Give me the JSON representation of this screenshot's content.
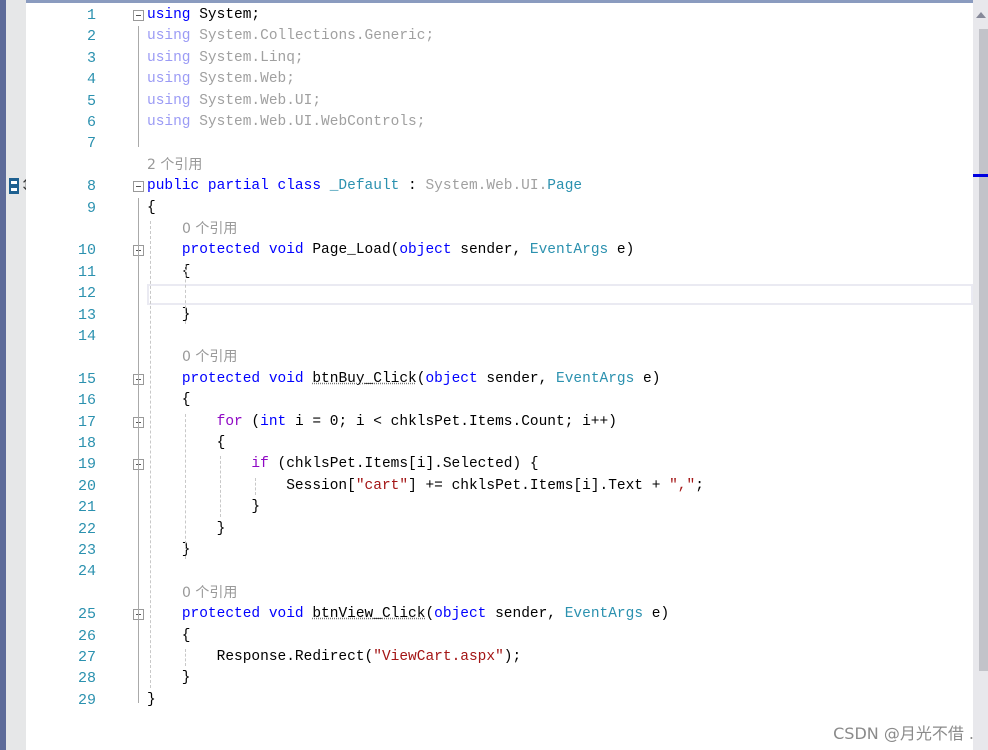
{
  "editor": {
    "rows": [
      {
        "num": "1",
        "tokens": [
          [
            "using",
            "kw"
          ],
          [
            " System;",
            "plain"
          ]
        ]
      },
      {
        "num": "2",
        "tokens": [
          [
            "using",
            "fkw"
          ],
          [
            " System.Collections.Generic;",
            "fade"
          ]
        ]
      },
      {
        "num": "3",
        "tokens": [
          [
            "using",
            "fkw"
          ],
          [
            " System.Linq;",
            "fade"
          ]
        ]
      },
      {
        "num": "4",
        "tokens": [
          [
            "using",
            "fkw"
          ],
          [
            " System.Web;",
            "fade"
          ]
        ]
      },
      {
        "num": "5",
        "tokens": [
          [
            "using",
            "fkw"
          ],
          [
            " System.Web.UI;",
            "fade"
          ]
        ]
      },
      {
        "num": "6",
        "tokens": [
          [
            "using",
            "fkw"
          ],
          [
            " System.Web.UI.WebControls;",
            "fade"
          ]
        ]
      },
      {
        "num": "7",
        "tokens": []
      },
      {
        "lens": "2 个引用"
      },
      {
        "num": "8",
        "tokens": [
          [
            "public partial class ",
            "kw"
          ],
          [
            "_Default",
            "type"
          ],
          [
            " : ",
            "plain"
          ],
          [
            "System.Web.UI.",
            "fade"
          ],
          [
            "Page",
            "type"
          ]
        ]
      },
      {
        "num": "9",
        "tokens": [
          [
            "{",
            "plain"
          ]
        ]
      },
      {
        "lens": "0 个引用",
        "indent": 1
      },
      {
        "num": "10",
        "tokens": [
          [
            "    ",
            "plain"
          ],
          [
            "protected void ",
            "kw"
          ],
          [
            "Page_Load(",
            "plain"
          ],
          [
            "object",
            "kw"
          ],
          [
            " sender, ",
            "plain"
          ],
          [
            "EventArgs",
            "type"
          ],
          [
            " e)",
            "plain"
          ]
        ]
      },
      {
        "num": "11",
        "tokens": [
          [
            "    {",
            "plain"
          ]
        ]
      },
      {
        "num": "12",
        "tokens": []
      },
      {
        "num": "13",
        "tokens": [
          [
            "    }",
            "plain"
          ]
        ]
      },
      {
        "num": "14",
        "tokens": []
      },
      {
        "lens": "0 个引用",
        "indent": 1
      },
      {
        "num": "15",
        "tokens": [
          [
            "    ",
            "plain"
          ],
          [
            "protected void ",
            "kw"
          ],
          [
            "btnBuy_Click",
            "plain",
            "u"
          ],
          [
            "(",
            "plain"
          ],
          [
            "object",
            "kw"
          ],
          [
            " sender, ",
            "plain"
          ],
          [
            "EventArgs",
            "type"
          ],
          [
            " e)",
            "plain"
          ]
        ]
      },
      {
        "num": "16",
        "tokens": [
          [
            "    {",
            "plain"
          ]
        ]
      },
      {
        "num": "17",
        "tokens": [
          [
            "        ",
            "plain"
          ],
          [
            "for",
            "kwc"
          ],
          [
            " (",
            "plain"
          ],
          [
            "int",
            "kw"
          ],
          [
            " i = 0; i < chklsPet.Items.Count; i++)",
            "plain"
          ]
        ]
      },
      {
        "num": "18",
        "tokens": [
          [
            "        {",
            "plain"
          ]
        ]
      },
      {
        "num": "19",
        "tokens": [
          [
            "            ",
            "plain"
          ],
          [
            "if",
            "kwc"
          ],
          [
            " (chklsPet.Items[i].Selected) {",
            "plain"
          ]
        ]
      },
      {
        "num": "20",
        "tokens": [
          [
            "                Session[",
            "plain"
          ],
          [
            "\"cart\"",
            "str"
          ],
          [
            "] += chklsPet.Items[i].Text + ",
            "plain"
          ],
          [
            "\",\"",
            "str"
          ],
          [
            ";",
            "plain"
          ]
        ]
      },
      {
        "num": "21",
        "tokens": [
          [
            "            }",
            "plain"
          ]
        ]
      },
      {
        "num": "22",
        "tokens": [
          [
            "        }",
            "plain"
          ]
        ]
      },
      {
        "num": "23",
        "tokens": [
          [
            "    }",
            "plain"
          ]
        ]
      },
      {
        "num": "24",
        "tokens": []
      },
      {
        "lens": "0 个引用",
        "indent": 1
      },
      {
        "num": "25",
        "tokens": [
          [
            "    ",
            "plain"
          ],
          [
            "protected void ",
            "kw"
          ],
          [
            "btnView_Click",
            "plain",
            "u"
          ],
          [
            "(",
            "plain"
          ],
          [
            "object",
            "kw"
          ],
          [
            " sender, ",
            "plain"
          ],
          [
            "EventArgs",
            "type"
          ],
          [
            " e)",
            "plain"
          ]
        ]
      },
      {
        "num": "26",
        "tokens": [
          [
            "    {",
            "plain"
          ]
        ]
      },
      {
        "num": "27",
        "tokens": [
          [
            "        Response.Redirect(",
            "plain"
          ],
          [
            "\"ViewCart.aspx\"",
            "str"
          ],
          [
            ");",
            "plain"
          ]
        ]
      },
      {
        "num": "28",
        "tokens": [
          [
            "    }",
            "plain"
          ]
        ]
      },
      {
        "num": "29",
        "tokens": [
          [
            "}",
            "plain"
          ]
        ]
      }
    ],
    "current_line": "12",
    "colors": {
      "keyword": "#0000ff",
      "control": "#8f08c4",
      "type": "#2b91af",
      "string": "#a31515",
      "line_number": "#2b91af",
      "codelens": "#999999"
    }
  },
  "watermark": "CSDN @月光不借 ."
}
